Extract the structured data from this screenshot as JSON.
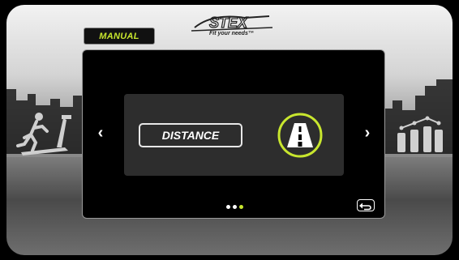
{
  "brand": {
    "logo_text": "STEX",
    "tagline": "Fit your needs™"
  },
  "mode_tab": {
    "label": "MANUAL"
  },
  "selector": {
    "option_label": "DISTANCE",
    "option_icon": "road-icon"
  },
  "navigation": {
    "prev_icon": "chevron-left-icon",
    "next_icon": "chevron-right-icon",
    "prev_glyph": "‹",
    "next_glyph": "›"
  },
  "pager": {
    "total": 3,
    "active_index": 2
  },
  "colors": {
    "accent": "#c8e62e",
    "panel": "#000000",
    "inner_panel": "#2d2d2d",
    "dot_inactive": "#ffffff"
  },
  "decorations": {
    "left_image": "treadmill-runner-icon",
    "right_image": "bar-chart-icon"
  }
}
